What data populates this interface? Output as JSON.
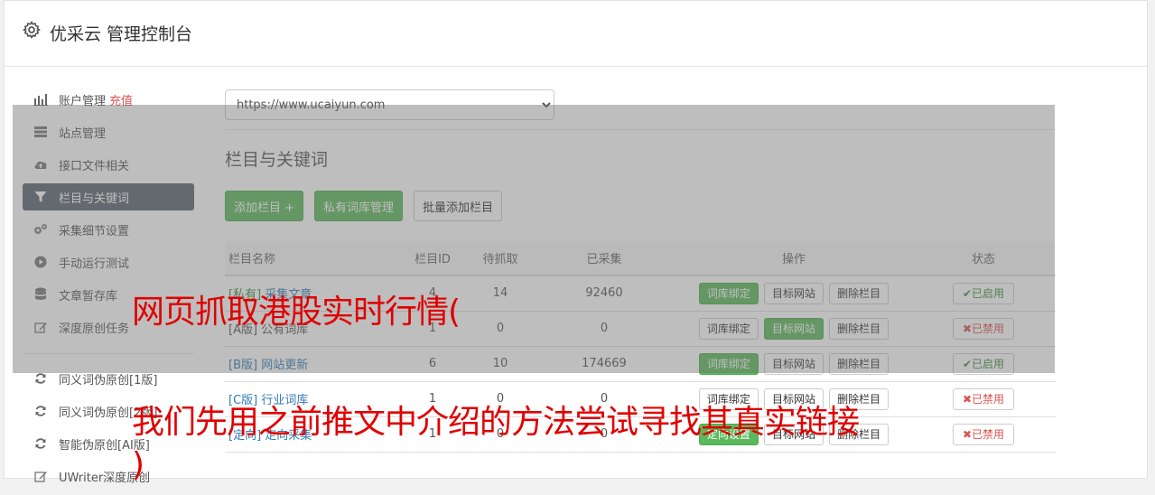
{
  "header": {
    "title": "优采云 管理控制台"
  },
  "sidebar": {
    "items": [
      {
        "label": "账户管理",
        "extra": "充值",
        "icon": "bar-chart-icon"
      },
      {
        "label": "站点管理",
        "icon": "server-icon"
      },
      {
        "label": "接口文件相关",
        "icon": "cloud-upload-icon"
      },
      {
        "label": "栏目与关键词",
        "icon": "filter-icon",
        "active": true
      },
      {
        "label": "采集细节设置",
        "icon": "cogs-icon"
      },
      {
        "label": "手动运行测试",
        "icon": "play-circle-icon"
      },
      {
        "label": "文章暂存库",
        "icon": "database-icon"
      },
      {
        "label": "深度原创任务",
        "icon": "edit-icon"
      }
    ],
    "items2": [
      {
        "label": "同义词伪原创[1版]",
        "icon": "refresh-icon"
      },
      {
        "label": "同义词伪原创[2版]",
        "icon": "refresh-icon"
      },
      {
        "label": "智能伪原创[AI版]",
        "icon": "refresh-icon"
      },
      {
        "label": "UWriter深度原创",
        "icon": "edit-icon"
      }
    ]
  },
  "main": {
    "site_select": "https://www.ucaiyun.com",
    "section_title": "栏目与关键词",
    "buttons": {
      "add": "添加栏目 +",
      "private": "私有词库管理",
      "batch": "批量添加栏目"
    },
    "table": {
      "headers": [
        "栏目名称",
        "栏目ID",
        "待抓取",
        "已采集",
        "操作",
        "状态"
      ],
      "rows": [
        {
          "tag": "[私有]",
          "name": "采集文章",
          "id": "4",
          "pending": "14",
          "collected": "92460",
          "btn1": "词库绑定",
          "btn2": "目标网站",
          "btn3": "删除栏目",
          "status": "✔已启用"
        },
        {
          "tag": "[A版]",
          "name": "公有词库",
          "id": "1",
          "pending": "0",
          "collected": "0",
          "btn1": "词库绑定",
          "btn2": "目标网站",
          "btn3": "删除栏目",
          "status": "✖已禁用"
        },
        {
          "tag": "[B版]",
          "name": "网站更新",
          "id": "6",
          "pending": "10",
          "collected": "174669",
          "btn1": "词库绑定",
          "btn2": "目标网站",
          "btn3": "删除栏目",
          "status": "✔已启用"
        },
        {
          "tag": "[C版]",
          "name": "行业词库",
          "id": "1",
          "pending": "0",
          "collected": "0",
          "btn1": "词库绑定",
          "btn2": "目标网站",
          "btn3": "删除栏目",
          "status": "✖已禁用"
        },
        {
          "tag": "[定向]",
          "name": "定向采集",
          "id": "1",
          "pending": "0",
          "collected": "0",
          "btn1": "定向设置",
          "btn2": "目标网站",
          "btn3": "删除栏目",
          "status": "✖已禁用"
        }
      ]
    }
  },
  "overlay": {
    "line1": "网页抓取港股实时行情(",
    "line2": "我们先用之前推文中介绍的方法尝试寻找其真实链接",
    "line3": ")"
  },
  "colors": {
    "green": "#5cb85c",
    "active_nav": "#5a6470",
    "overlay_text": "#e00000",
    "danger": "#d9534f"
  }
}
